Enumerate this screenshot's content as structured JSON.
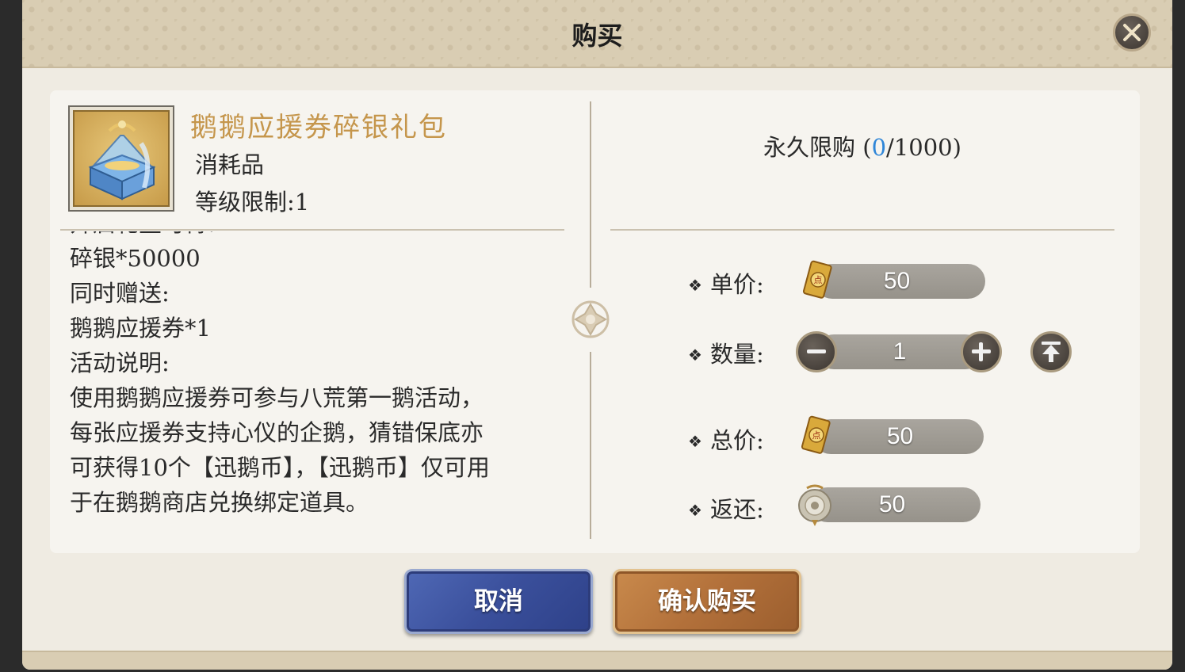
{
  "dialog": {
    "title": "购买"
  },
  "item": {
    "name": "鹅鹅应援券碎银礼包",
    "type": "消耗品",
    "level_limit": "等级限制:1",
    "icon": "treasure-chest-icon"
  },
  "description": {
    "lines": [
      "开启礼盒可得:",
      "碎银*50000",
      "同时赠送:",
      "鹅鹅应援券*1",
      "活动说明:",
      "使用鹅鹅应援券可参与八荒第一鹅活动，",
      "每张应援券支持心仪的企鹅，猜错保底亦",
      "可获得10个【迅鹅币】，【迅鹅币】仅可用",
      "于在鹅鹅商店兑换绑定道具。"
    ]
  },
  "purchase_limit": {
    "label": "永久限购",
    "open": "(",
    "current": "0",
    "sep_max": "/1000",
    "close": ")"
  },
  "rows": {
    "unit_price": {
      "label": "单价:",
      "value": "50",
      "icon": "point-scroll-icon"
    },
    "quantity": {
      "label": "数量:",
      "value": "1"
    },
    "total_price": {
      "label": "总价:",
      "value": "50",
      "icon": "point-scroll-icon"
    },
    "rebate": {
      "label": "返还:",
      "value": "50",
      "icon": "jade-coin-icon"
    }
  },
  "buttons": {
    "cancel": "取消",
    "confirm": "确认购买"
  },
  "colors": {
    "item_name": "#c5964c",
    "limit_current": "#2f86d8",
    "cancel_button": "#3a4f9b",
    "confirm_button": "#b2703a"
  }
}
